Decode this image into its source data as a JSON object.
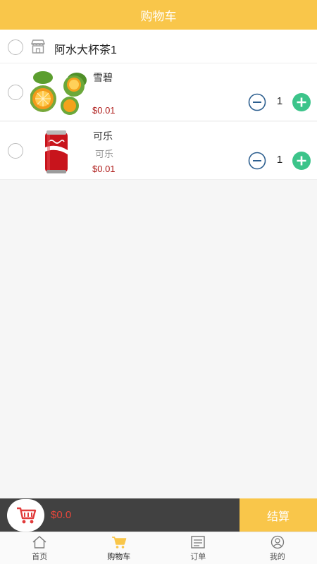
{
  "header": {
    "title": "购物车"
  },
  "store": {
    "name": "阿水大杯茶1"
  },
  "items": [
    {
      "name": "雪碧",
      "subtitle": "",
      "price": "$0.01",
      "quantity": "1"
    },
    {
      "name": "可乐",
      "subtitle": "可乐",
      "price": "$0.01",
      "quantity": "1"
    }
  ],
  "checkout": {
    "total": "$0.0",
    "button_label": "结算"
  },
  "tabs": [
    {
      "label": "首页",
      "icon": "home-icon"
    },
    {
      "label": "购物车",
      "icon": "cart-icon"
    },
    {
      "label": "订单",
      "icon": "list-icon"
    },
    {
      "label": "我的",
      "icon": "user-icon"
    }
  ],
  "colors": {
    "accent": "#f9c64a",
    "price": "#b0201e",
    "plus": "#3cc48a",
    "minus": "#2d5f8f",
    "bar": "#414141"
  }
}
